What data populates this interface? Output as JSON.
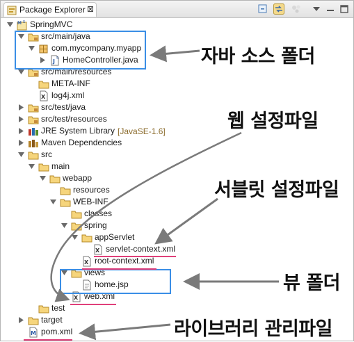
{
  "view": {
    "tab_label": "Package Explorer",
    "tab_close": "⊠"
  },
  "tree": [
    {
      "label": "SpringMVC",
      "depth": 0,
      "expanded": true,
      "icon": "maven-project-icon"
    },
    {
      "label": "src/main/java",
      "depth": 1,
      "expanded": true,
      "icon": "source-folder-icon"
    },
    {
      "label": "com.mycompany.myapp",
      "depth": 2,
      "expanded": true,
      "icon": "package-icon"
    },
    {
      "label": "HomeController.java",
      "depth": 3,
      "expanded": false,
      "icon": "java-file-icon"
    },
    {
      "label": "src/main/resources",
      "depth": 1,
      "expanded": true,
      "icon": "source-folder-icon"
    },
    {
      "label": "META-INF",
      "depth": 2,
      "expanded": null,
      "icon": "folder-icon"
    },
    {
      "label": "log4j.xml",
      "depth": 2,
      "expanded": null,
      "icon": "xml-file-icon"
    },
    {
      "label": "src/test/java",
      "depth": 1,
      "expanded": false,
      "icon": "source-folder-icon"
    },
    {
      "label": "src/test/resources",
      "depth": 1,
      "expanded": false,
      "icon": "source-folder-icon"
    },
    {
      "label": "JRE System Library",
      "decoration": "[JavaSE-1.6]",
      "depth": 1,
      "expanded": false,
      "icon": "library-icon"
    },
    {
      "label": "Maven Dependencies",
      "depth": 1,
      "expanded": false,
      "icon": "maven-library-icon"
    },
    {
      "label": "src",
      "depth": 1,
      "expanded": true,
      "icon": "folder-icon"
    },
    {
      "label": "main",
      "depth": 2,
      "expanded": true,
      "icon": "folder-icon"
    },
    {
      "label": "webapp",
      "depth": 3,
      "expanded": true,
      "icon": "folder-icon"
    },
    {
      "label": "resources",
      "depth": 4,
      "expanded": null,
      "icon": "folder-icon"
    },
    {
      "label": "WEB-INF",
      "depth": 4,
      "expanded": true,
      "icon": "folder-icon"
    },
    {
      "label": "classes",
      "depth": 5,
      "expanded": null,
      "icon": "folder-icon"
    },
    {
      "label": "spring",
      "depth": 5,
      "expanded": true,
      "icon": "folder-icon"
    },
    {
      "label": "appServlet",
      "depth": 6,
      "expanded": true,
      "icon": "folder-icon"
    },
    {
      "label": "servlet-context.xml",
      "depth": 7,
      "expanded": null,
      "icon": "xml-file-icon"
    },
    {
      "label": "root-context.xml",
      "depth": 6,
      "expanded": null,
      "icon": "xml-file-icon"
    },
    {
      "label": "views",
      "depth": 5,
      "expanded": true,
      "icon": "folder-icon"
    },
    {
      "label": "home.jsp",
      "depth": 6,
      "expanded": null,
      "icon": "jsp-file-icon"
    },
    {
      "label": "web.xml",
      "depth": 5,
      "expanded": null,
      "icon": "xml-file-icon"
    },
    {
      "label": "test",
      "depth": 2,
      "expanded": null,
      "icon": "folder-icon"
    },
    {
      "label": "target",
      "depth": 1,
      "expanded": false,
      "icon": "folder-icon"
    },
    {
      "label": "pom.xml",
      "depth": 1,
      "expanded": null,
      "icon": "maven-pom-icon"
    }
  ],
  "annotations": {
    "java_source": "자바 소스 폴더",
    "web_config": "웹 설정파일",
    "servlet_config": "서블릿 설정파일",
    "view_folder": "뷰 폴더",
    "library_config": "라이브러리 관리파일"
  },
  "colors": {
    "highlight_box": "#3a8ee6",
    "underline": "#e0407a",
    "arrow": "#7a7a7a"
  }
}
